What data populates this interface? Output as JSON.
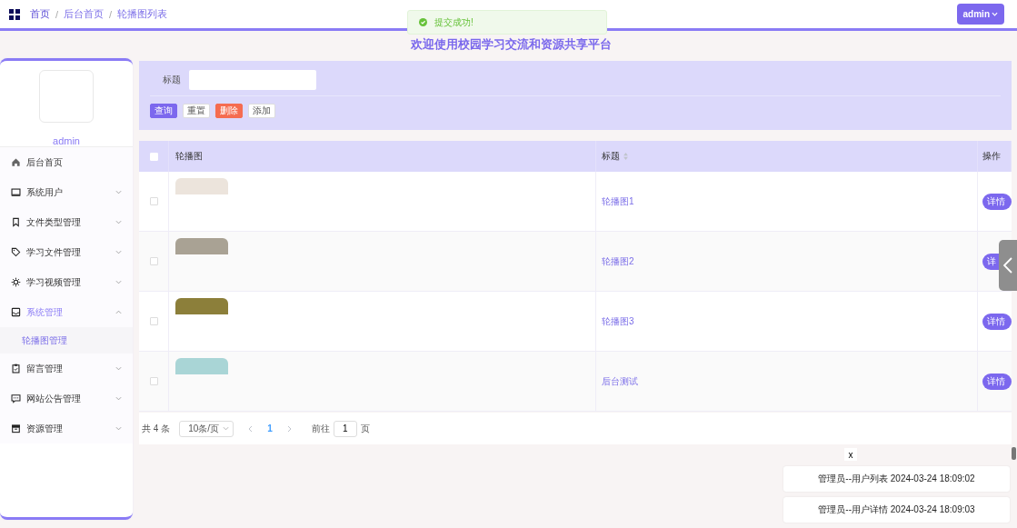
{
  "breadcrumb": [
    {
      "label": "首页"
    },
    {
      "separator": "/",
      "label": "后台首页"
    },
    {
      "separator": "/",
      "label": "轮播图列表"
    }
  ],
  "toast": {
    "text": "提交成功!"
  },
  "user_menu": {
    "label": "admin"
  },
  "site_title": "欢迎使用校园学习交流和资源共享平台",
  "sidebar": {
    "username": "admin",
    "items": [
      {
        "label": "后台首页"
      },
      {
        "label": "系统用户",
        "expanded": false
      },
      {
        "label": "文件类型管理",
        "expanded": false
      },
      {
        "label": "学习文件管理",
        "expanded": false
      },
      {
        "label": "学习视频管理",
        "expanded": false
      },
      {
        "label": "系统管理",
        "expanded": true,
        "children": [
          {
            "label": "轮播图管理",
            "selected": true
          }
        ]
      },
      {
        "label": "留言管理",
        "expanded": false
      },
      {
        "label": "网站公告管理",
        "expanded": false
      },
      {
        "label": "资源管理",
        "expanded": false
      }
    ]
  },
  "search": {
    "label": "标题"
  },
  "buttons": [
    {
      "label": "查询",
      "kind": "primary"
    },
    {
      "label": "重置",
      "kind": "plain"
    },
    {
      "label": "删除",
      "kind": "danger"
    },
    {
      "label": "添加",
      "kind": "plain"
    }
  ],
  "table": {
    "header_checked": false,
    "columns": [
      "轮播图",
      "标题",
      "操作"
    ],
    "rows": [
      {
        "checked": false,
        "title": "轮播图1",
        "action": "详情"
      },
      {
        "checked": false,
        "title": "轮播图2",
        "action": "详"
      },
      {
        "checked": false,
        "title": "轮播图3",
        "action": "详情"
      },
      {
        "checked": false,
        "title": "后台测试",
        "action": "详情"
      }
    ]
  },
  "pagination": {
    "total": "共 4 条",
    "page_size": "10条/页",
    "pages": [
      {
        "label": "1",
        "selected": true
      }
    ],
    "goto_label": "前往",
    "goto_value": "1",
    "page_suffix": "页"
  },
  "history": {
    "close": "x",
    "entries": [
      "管理员--用户列表 2024-03-24 18:09:02",
      "管理员--用户详情 2024-03-24 18:09:03"
    ]
  }
}
